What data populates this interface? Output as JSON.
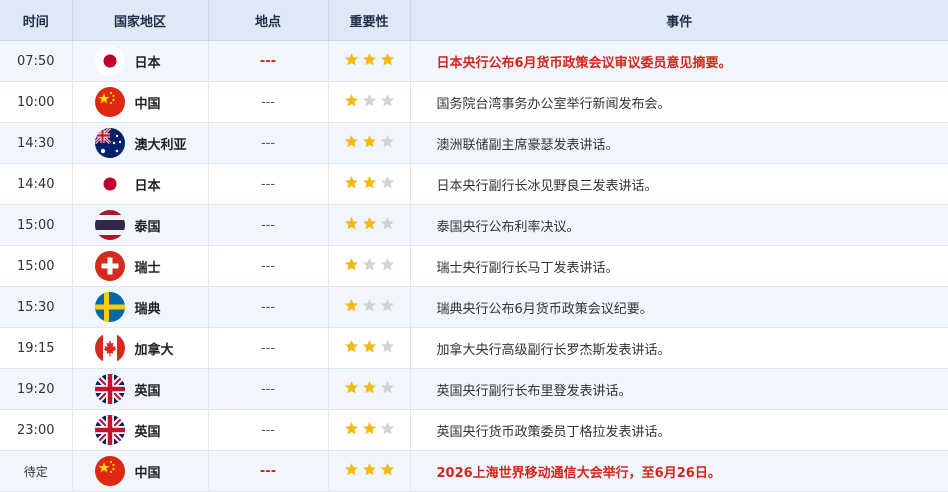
{
  "headers": [
    "时间",
    "国家地区",
    "地点",
    "重要性",
    "事件"
  ],
  "colors": {
    "highlight": "#d0261c",
    "star_on": "#f5b819",
    "star_off": "#d2d2d2"
  },
  "rows": [
    {
      "time": "07:50",
      "country": "日本",
      "flag": "japan-flag",
      "location": "---",
      "stars": 3,
      "event": "日本央行公布6月货币政策会议审议委员意见摘要。",
      "highlight": true
    },
    {
      "time": "10:00",
      "country": "中国",
      "flag": "china-flag",
      "location": "---",
      "stars": 1,
      "event": "国务院台湾事务办公室举行新闻发布会。",
      "highlight": false
    },
    {
      "time": "14:30",
      "country": "澳大利亚",
      "flag": "australia-flag",
      "location": "---",
      "stars": 2,
      "event": "澳洲联储副主席豪瑟发表讲话。",
      "highlight": false
    },
    {
      "time": "14:40",
      "country": "日本",
      "flag": "japan-flag",
      "location": "---",
      "stars": 2,
      "event": "日本央行副行长冰见野良三发表讲话。",
      "highlight": false
    },
    {
      "time": "15:00",
      "country": "泰国",
      "flag": "thailand-flag",
      "location": "---",
      "stars": 2,
      "event": "泰国央行公布利率决议。",
      "highlight": false
    },
    {
      "time": "15:00",
      "country": "瑞士",
      "flag": "switzerland-flag",
      "location": "---",
      "stars": 1,
      "event": "瑞士央行副行长马丁发表讲话。",
      "highlight": false
    },
    {
      "time": "15:30",
      "country": "瑞典",
      "flag": "sweden-flag",
      "location": "---",
      "stars": 1,
      "event": "瑞典央行公布6月货币政策会议纪要。",
      "highlight": false
    },
    {
      "time": "19:15",
      "country": "加拿大",
      "flag": "canada-flag",
      "location": "---",
      "stars": 2,
      "event": "加拿大央行高级副行长罗杰斯发表讲话。",
      "highlight": false
    },
    {
      "time": "19:20",
      "country": "英国",
      "flag": "uk-flag",
      "location": "---",
      "stars": 2,
      "event": "英国央行副行长布里登发表讲话。",
      "highlight": false
    },
    {
      "time": "23:00",
      "country": "英国",
      "flag": "uk-flag",
      "location": "---",
      "stars": 2,
      "event": "英国央行货币政策委员丁格拉发表讲话。",
      "highlight": false
    },
    {
      "time": "待定",
      "country": "中国",
      "flag": "china-flag",
      "location": "---",
      "stars": 3,
      "event": "2026上海世界移动通信大会举行，至6月26日。",
      "highlight": true
    }
  ]
}
